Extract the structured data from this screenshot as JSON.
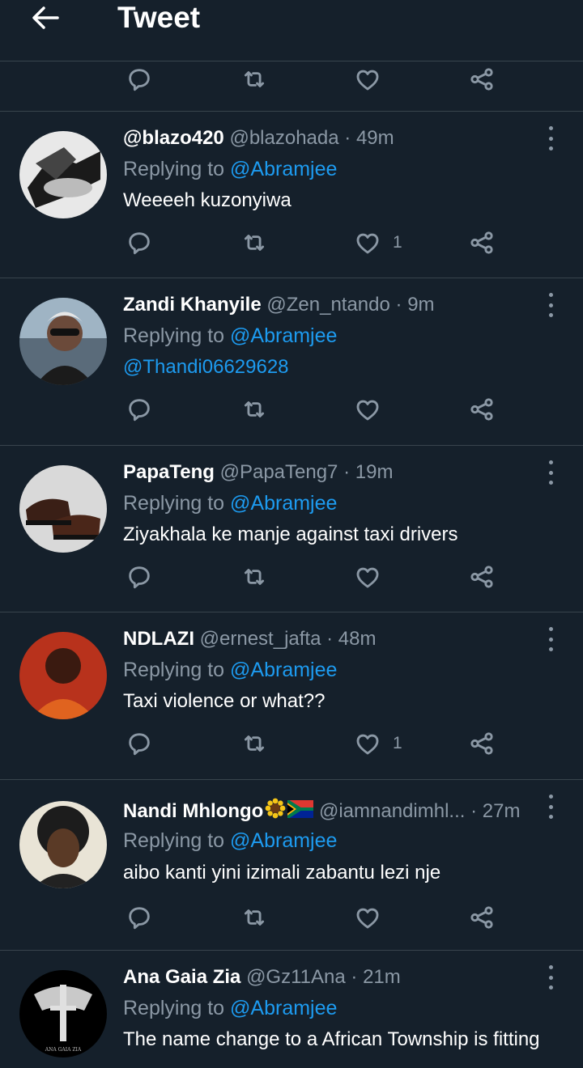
{
  "header": {
    "title": "Tweet",
    "back_icon": "arrow-left-icon"
  },
  "colors": {
    "background": "#15202b",
    "border": "#38444d",
    "muted": "#8b98a5",
    "accent": "#1d9bf0"
  },
  "tweets": [
    {
      "name": "@blazo420",
      "handle": "@blazohada",
      "dot": "·",
      "time": "49m",
      "replying_label": "Replying to",
      "replying_to": "@Abramjee",
      "text": "Weeeeh kuzonyiwa",
      "like_count": "1"
    },
    {
      "name": "Zandi Khanyile",
      "handle": "@Zen_ntando",
      "dot": "·",
      "time": "9m",
      "replying_label": "Replying to",
      "replying_to": "@Abramjee",
      "text": "@Thandi06629628",
      "like_count": ""
    },
    {
      "name": "PapaTeng",
      "handle": "@PapaTeng7",
      "dot": "·",
      "time": "19m",
      "replying_label": "Replying to",
      "replying_to": "@Abramjee",
      "text": "Ziyakhala ke manje against taxi drivers",
      "like_count": ""
    },
    {
      "name": "NDLAZI",
      "handle": "@ernest_jafta",
      "dot": "·",
      "time": "48m",
      "replying_label": "Replying to",
      "replying_to": "@Abramjee",
      "text": "Taxi violence or what??",
      "like_count": "1"
    },
    {
      "name": "Nandi Mhlongo",
      "name_emojis": [
        "sunflower-emoji",
        "south-africa-flag-emoji"
      ],
      "handle": "@iamnandimhl...",
      "dot": "·",
      "time": "27m",
      "replying_label": "Replying to",
      "replying_to": "@Abramjee",
      "text": "aibo kanti yini izimali zabantu lezi nje",
      "like_count": ""
    },
    {
      "name": "Ana Gaia Zia",
      "handle": "@Gz11Ana",
      "dot": "·",
      "time": "21m",
      "replying_label": "Replying to",
      "replying_to": "@Abramjee",
      "text": "The name change to a African Township is fitting",
      "like_count": "",
      "avatar_text": "ANA GAIA ZIA"
    }
  ]
}
